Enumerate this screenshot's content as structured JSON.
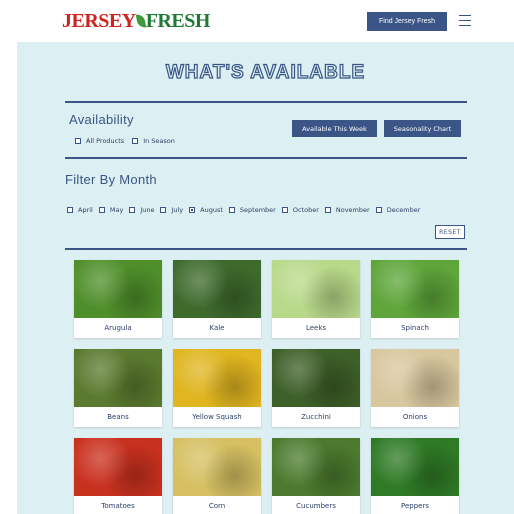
{
  "header": {
    "logo_left": "JERSEY",
    "logo_right": "FRESH",
    "find_button": "Find Jersey Fresh"
  },
  "title": "WHAT'S AVAILABLE",
  "availability": {
    "label": "Availability",
    "options": [
      {
        "label": "All Products",
        "checked": false
      },
      {
        "label": "In Season",
        "checked": false
      }
    ],
    "buttons": [
      "Available This Week",
      "Seasonality Chart"
    ]
  },
  "filter": {
    "label": "Filter By Month",
    "months": [
      {
        "label": "April",
        "checked": false
      },
      {
        "label": "May",
        "checked": false
      },
      {
        "label": "June",
        "checked": false
      },
      {
        "label": "July",
        "checked": false
      },
      {
        "label": "August",
        "checked": true
      },
      {
        "label": "September",
        "checked": false
      },
      {
        "label": "October",
        "checked": false
      },
      {
        "label": "November",
        "checked": false
      },
      {
        "label": "December",
        "checked": false
      }
    ],
    "reset": "RESET"
  },
  "products": [
    {
      "name": "Arugula",
      "color": "#4f8f2a"
    },
    {
      "name": "Kale",
      "color": "#3e6a2c"
    },
    {
      "name": "Leeks",
      "color": "#b9d98a"
    },
    {
      "name": "Spinach",
      "color": "#5ea53a"
    },
    {
      "name": "Beans",
      "color": "#5b7a2f"
    },
    {
      "name": "Yellow Squash",
      "color": "#e0b520"
    },
    {
      "name": "Zucchini",
      "color": "#3d5f28"
    },
    {
      "name": "Onions",
      "color": "#d8c79e"
    },
    {
      "name": "Tomatoes",
      "color": "#c9311f"
    },
    {
      "name": "Corn",
      "color": "#d6c062"
    },
    {
      "name": "Cucumbers",
      "color": "#4c7a2e"
    },
    {
      "name": "Peppers",
      "color": "#2f7a26"
    }
  ]
}
